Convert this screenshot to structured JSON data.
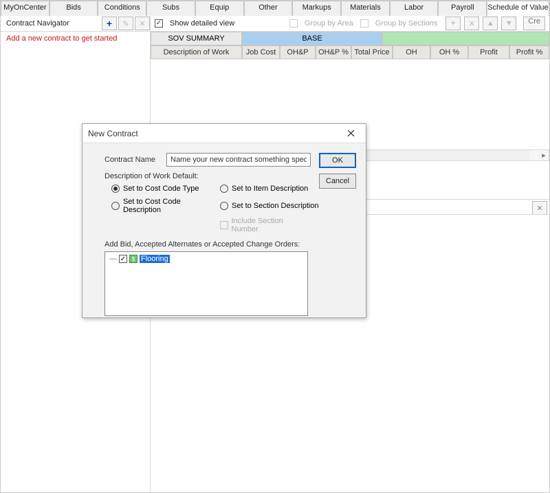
{
  "tabs": [
    "MyOnCenter",
    "Bids",
    "Conditions",
    "Subs",
    "Equip",
    "Other",
    "Markups",
    "Materials",
    "Labor",
    "Payroll",
    "Schedule of Values"
  ],
  "activeTabIndex": 10,
  "navigator": {
    "title": "Contract Navigator",
    "hint": "Add a new contract to get started"
  },
  "toolbar": {
    "showDetailed": "Show detailed view",
    "groupByArea": "Group by Area",
    "groupBySections": "Group by Sections",
    "createBtn": "Cre"
  },
  "groupHeaders": {
    "sov": "SOV SUMMARY",
    "base": "BASE"
  },
  "columns": [
    "Description of Work",
    "Job Cost",
    "OH&P",
    "OH&P %",
    "Total Price",
    "OH",
    "OH %",
    "Profit",
    "Profit %"
  ],
  "closePanelIcon": "✕",
  "dialog": {
    "title": "New Contract",
    "contractNameLabel": "Contract Name",
    "contractNameValue": "Name your new contract something specific",
    "ok": "OK",
    "cancel": "Cancel",
    "descGroup": "Description of Work Default:",
    "r1": "Set to Cost Code Type",
    "r2": "Set to Item Description",
    "r3": "Set to Cost Code Description",
    "r4": "Set to Section Description",
    "includeSection": "Include Section Number",
    "addLabel": "Add Bid, Accepted Alternates or Accepted Change Orders:",
    "treeItem": "Flooring"
  }
}
